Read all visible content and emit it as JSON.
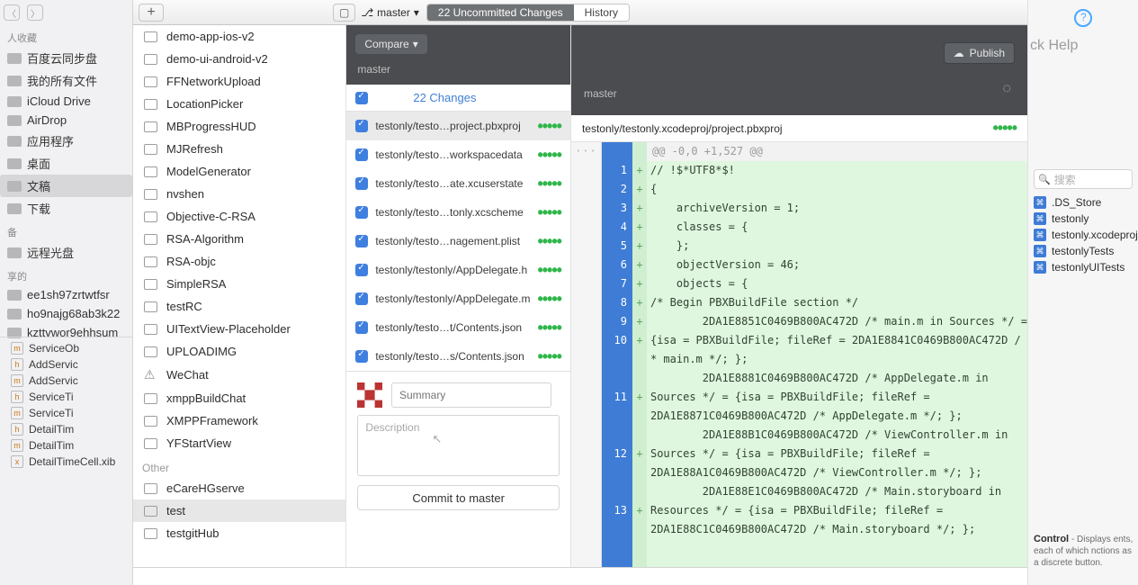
{
  "finder": {
    "favorites_header": "人收藏",
    "items": [
      {
        "label": "百度云同步盘",
        "icon": "folder"
      },
      {
        "label": "我的所有文件",
        "icon": "all"
      },
      {
        "label": "iCloud Drive",
        "icon": "cloud"
      },
      {
        "label": "AirDrop",
        "icon": "airdrop"
      },
      {
        "label": "应用程序",
        "icon": "apps"
      },
      {
        "label": "桌面",
        "icon": "desktop"
      },
      {
        "label": "文稿",
        "icon": "docs",
        "selected": true
      },
      {
        "label": "下载",
        "icon": "downloads"
      }
    ],
    "devices_header": "备",
    "devices": [
      {
        "label": "远程光盘"
      }
    ],
    "shared_header": "享的",
    "shared": [
      {
        "label": "ee1sh97zrtwtfsr"
      },
      {
        "label": "ho9najg68ab3k22"
      },
      {
        "label": "kzttvwor9ehhsum"
      }
    ],
    "xcode_files": [
      {
        "ext": "m",
        "name": "ServiceOb"
      },
      {
        "ext": "h",
        "name": "AddServic"
      },
      {
        "ext": "m",
        "name": "AddServic"
      },
      {
        "ext": "h",
        "name": "ServiceTi"
      },
      {
        "ext": "m",
        "name": "ServiceTi"
      },
      {
        "ext": "h",
        "name": "DetailTim"
      },
      {
        "ext": "m",
        "name": "DetailTim"
      },
      {
        "ext": "x",
        "name": "DetailTimeCell.xib"
      }
    ]
  },
  "toolbar": {
    "branch_selector": "master",
    "seg_active": "22 Uncommitted Changes",
    "seg_inactive": "History"
  },
  "repos": {
    "items": [
      "demo-app-ios-v2",
      "demo-ui-android-v2",
      "FFNetworkUpload",
      "LocationPicker",
      "MBProgressHUD",
      "MJRefresh",
      "ModelGenerator",
      "nvshen",
      "Objective-C-RSA",
      "RSA-Algorithm",
      "RSA-objc",
      "SimpleRSA",
      "testRC",
      "UITextView-Placeholder",
      "UPLOADIMG",
      "WeChat",
      "xmppBuildChat",
      "XMPPFramework",
      "YFStartView"
    ],
    "wechat_warn_index": 15,
    "other_header": "Other",
    "other": [
      "eCareHGserve",
      "test",
      "testgitHub"
    ],
    "active_other_index": 1
  },
  "compare": {
    "label": "Compare",
    "branch": "master",
    "publish": "Publish"
  },
  "changes": {
    "title": "22 Changes",
    "files": [
      {
        "name": "testonly/testo…project.pbxproj",
        "sel": true
      },
      {
        "name": "testonly/testo…workspacedata"
      },
      {
        "name": "testonly/testo…ate.xcuserstate"
      },
      {
        "name": "testonly/testo…tonly.xcscheme"
      },
      {
        "name": "testonly/testo…nagement.plist"
      },
      {
        "name": "testonly/testonly/AppDelegate.h"
      },
      {
        "name": "testonly/testonly/AppDelegate.m"
      },
      {
        "name": "testonly/testo…t/Contents.json"
      },
      {
        "name": "testonly/testo…s/Contents.json"
      }
    ]
  },
  "commit": {
    "summary_ph": "Summary",
    "desc_ph": "Description",
    "button": "Commit to master"
  },
  "diff": {
    "path": "testonly/testonly.xcodeproj/project.pbxproj",
    "hunk": "@@ -0,0 +1,527 @@",
    "new_lines": [
      "1",
      "2",
      "3",
      "4",
      "5",
      "6",
      "7",
      "8",
      "9",
      "10",
      "",
      "",
      "11",
      "",
      "",
      "12",
      "",
      "",
      "13",
      "",
      ""
    ],
    "plus": [
      "+",
      "+",
      "+",
      "+",
      "+",
      "+",
      "+",
      "+",
      "+",
      "+",
      "",
      "",
      "+",
      "",
      "",
      "+",
      "",
      "",
      "+",
      "",
      ""
    ],
    "code": [
      "// !$*UTF8*$!",
      "{",
      "    archiveVersion = 1;",
      "    classes = {",
      "    };",
      "    objectVersion = 46;",
      "    objects = {",
      "",
      "/* Begin PBXBuildFile section */",
      "        2DA1E8851C0469B800AC472D /* main.m in Sources */ =",
      "{isa = PBXBuildFile; fileRef = 2DA1E8841C0469B800AC472D /",
      "* main.m */; };",
      "        2DA1E8881C0469B800AC472D /* AppDelegate.m in",
      "Sources */ = {isa = PBXBuildFile; fileRef =",
      "2DA1E8871C0469B800AC472D /* AppDelegate.m */; };",
      "        2DA1E88B1C0469B800AC472D /* ViewController.m in",
      "Sources */ = {isa = PBXBuildFile; fileRef =",
      "2DA1E88A1C0469B800AC472D /* ViewController.m */; };",
      "        2DA1E88E1C0469B800AC472D /* Main.storyboard in",
      "Resources */ = {isa = PBXBuildFile; fileRef =",
      "2DA1E88C1C0469B800AC472D /* Main.storyboard */; };"
    ]
  },
  "right": {
    "help": "ck Help",
    "search_ph": "搜索",
    "files": [
      ".DS_Store",
      "testonly",
      "testonly.xcodeproj",
      "testonlyTests",
      "testonlyUITests"
    ],
    "foot_title": "Control",
    "foot_body": " - Displays\nents, each of which\nnctions as a discrete button."
  }
}
